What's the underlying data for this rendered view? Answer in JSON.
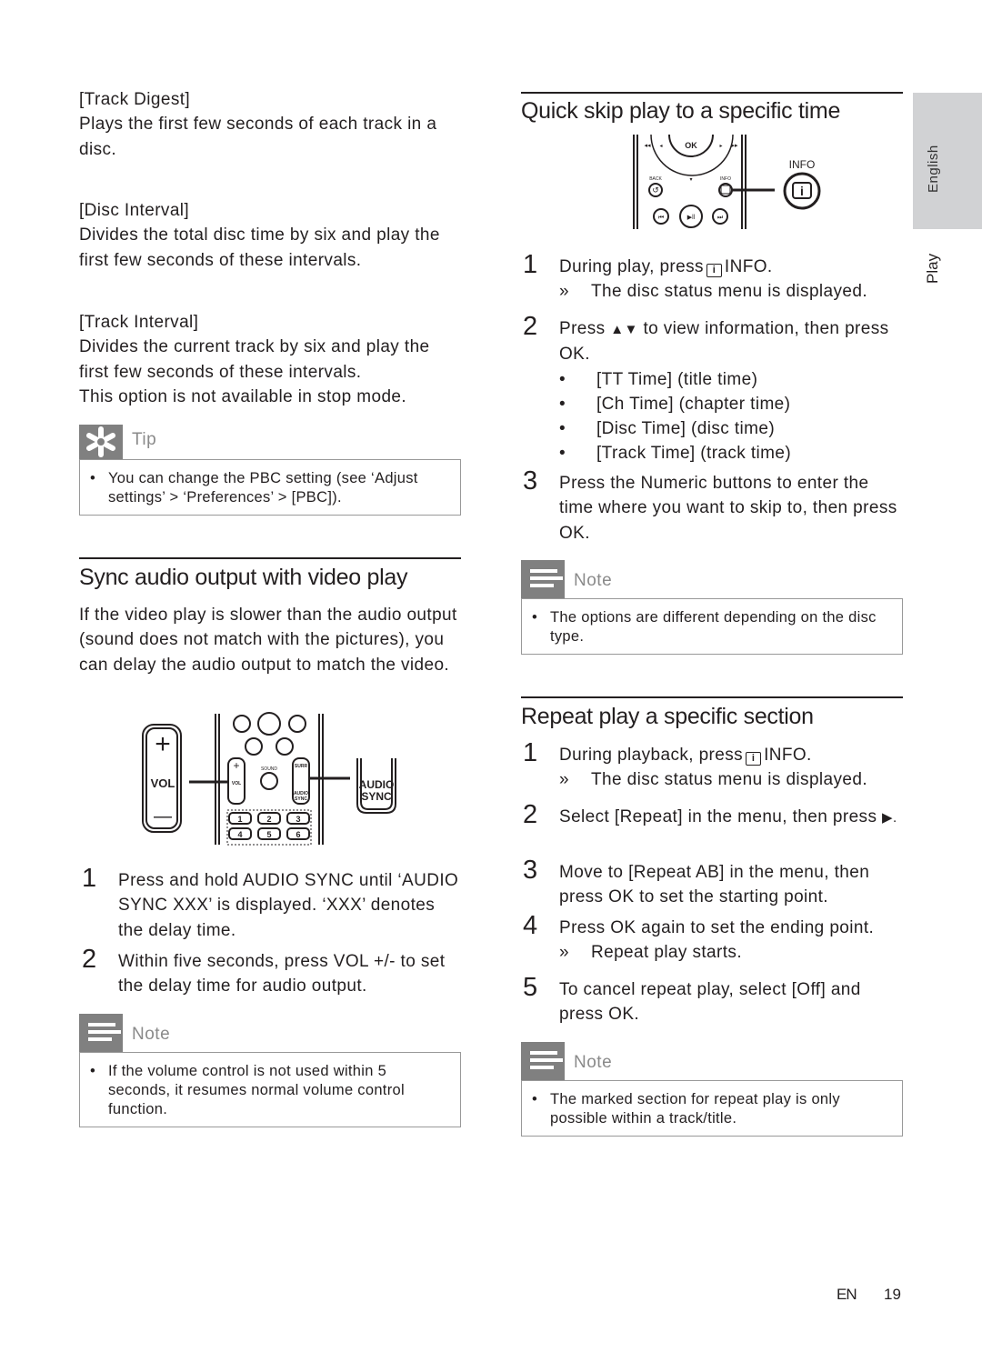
{
  "left": {
    "options": [
      {
        "label": "[Track Digest]",
        "desc": "Plays the first few seconds of each track in a disc."
      },
      {
        "label": "[Disc Interval]",
        "desc": "Divides the total disc time by six and play the first few seconds of these intervals."
      },
      {
        "label": "[Track Interval]",
        "desc": "Divides the current track by six and play the first few seconds of these intervals.",
        "extra": "This option is not available in stop mode."
      }
    ],
    "tip": {
      "label": "Tip",
      "icon": "asterisk-icon",
      "bullet": "•",
      "text": "You can change the PBC setting (see ‘Adjust settings’ > ‘Preferences’ > [PBC])."
    },
    "sync": {
      "title": "Sync audio output with video play",
      "intro": "If the video play is slower than the audio output (sound does not match with the pictures), you can delay the audio output to match the video.",
      "figure": {
        "vol": "VOL",
        "plus": "+",
        "minus": "—",
        "sound": "SOUND",
        "surr": "SURR",
        "audio": "AUDIO",
        "sync": "SYNC",
        "keys": [
          "1",
          "2",
          "3",
          "4",
          "5",
          "6"
        ]
      },
      "steps": [
        {
          "n": "1",
          "text": "Press and hold AUDIO SYNC until ‘AUDIO SYNC XXX’ is displayed. ‘XXX’ denotes the delay time."
        },
        {
          "n": "2",
          "text": "Within five seconds, press VOL +/- to set the delay time for audio output."
        }
      ],
      "note": {
        "label": "Note",
        "icon": "note-lines-icon",
        "bullet": "•",
        "text": "If the volume control is not used within 5 seconds, it resumes normal volume control function."
      }
    }
  },
  "right": {
    "skip": {
      "title": "Quick skip play to a specific time",
      "figure": {
        "ok": "OK",
        "back": "BACK",
        "info_small": "INFO",
        "info": "INFO",
        "info_glyph": "i"
      },
      "step1": {
        "n": "1",
        "pre": "During play, press",
        "icon": "i",
        "post": "INFO.",
        "result_marker": "»",
        "result": "The disc status menu is displayed."
      },
      "step2": {
        "n": "2",
        "pre": "Press",
        "arrows": "▲▼",
        "post": "to view information, then press OK.",
        "bullet": "•",
        "items": [
          "[TT Time] (title time)",
          "[Ch Time] (chapter time)",
          "[Disc Time] (disc time)",
          "[Track Time] (track time)"
        ]
      },
      "step3": {
        "n": "3",
        "text": "Press the Numeric buttons to enter the time where you want to skip to, then press OK."
      },
      "note": {
        "label": "Note",
        "bullet": "•",
        "text": "The options are different depending on the disc type."
      }
    },
    "repeat": {
      "title": "Repeat play a specific section",
      "step1": {
        "n": "1",
        "pre": "During playback, press",
        "icon": "i",
        "post": "INFO.",
        "result_marker": "»",
        "result": "The disc status menu is displayed."
      },
      "step2": {
        "n": "2",
        "text": "Select [Repeat] in the menu, then press",
        "play": "▶."
      },
      "step3": {
        "n": "3",
        "text": "Move to [Repeat AB] in the menu, then press OK to set the starting point."
      },
      "step4": {
        "n": "4",
        "text": "Press OK again to set the ending point.",
        "result_marker": "»",
        "result": "Repeat play starts."
      },
      "step5": {
        "n": "5",
        "text": "To cancel repeat play, select [Off] and press OK."
      },
      "note": {
        "label": "Note",
        "bullet": "•",
        "text": "The marked section for repeat play is only possible within a track/title."
      }
    }
  },
  "side_tab": {
    "language": "English",
    "section": "Play",
    "color": "#d1d2d4"
  },
  "footer": {
    "lang": "EN",
    "page": "19"
  }
}
